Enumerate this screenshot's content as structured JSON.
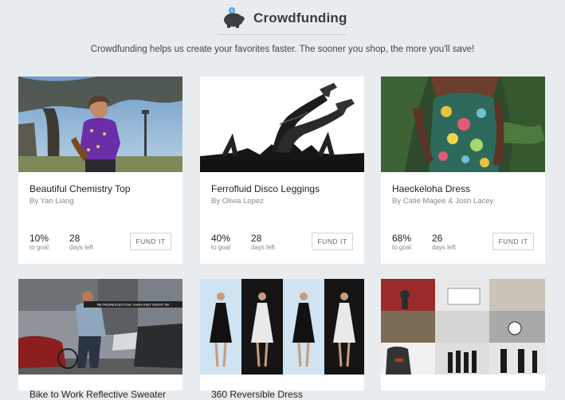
{
  "header": {
    "title": "Crowdfunding",
    "icon": "piggy-bank-icon",
    "subtitle": "Crowdfunding helps us create your favorites faster. The sooner you shop, the more you'll save!"
  },
  "cards": [
    {
      "name": "Beautiful Chemistry Top",
      "by": "By Yan Liang",
      "percent": "10%",
      "percent_label": "to goal",
      "days": "28",
      "days_label": "days left",
      "button": "FUND IT"
    },
    {
      "name": "Ferrofluid Disco Leggings",
      "by": "By Olivia Lopez",
      "percent": "40%",
      "percent_label": "to goal",
      "days": "28",
      "days_label": "days left",
      "button": "FUND IT"
    },
    {
      "name": "Haeckeloha Dress",
      "by": "By Catie Magee & Josh Lacey",
      "percent": "68%",
      "percent_label": "to goal",
      "days": "26",
      "days_label": "days left",
      "button": "FUND IT"
    },
    {
      "name": "Bike to Work Reflective Sweater",
      "photo_text": "RETROREFLECTIVE YARN KNIT RIGHT IN!"
    },
    {
      "name": "360 Reversible Dress"
    },
    {
      "name": ""
    }
  ],
  "colors": {
    "page_bg": "#e9ecee",
    "card_bg": "#ffffff",
    "title": "#3b3b3b",
    "button_border": "#cfd3d6"
  }
}
